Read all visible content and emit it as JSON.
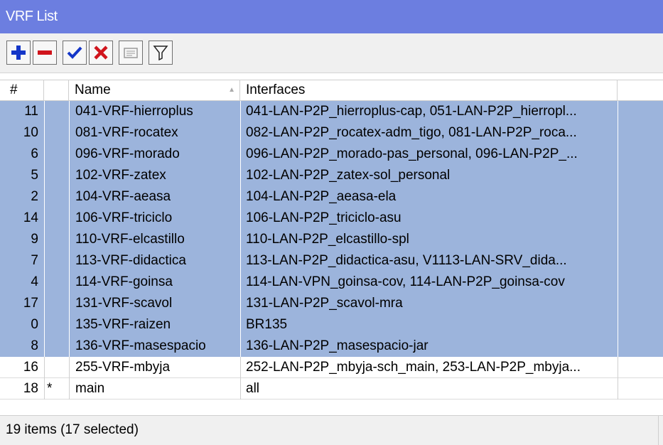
{
  "window": {
    "title": "VRF List"
  },
  "toolbar": {
    "buttons": [
      {
        "name": "add-button",
        "icon": "plus-icon"
      },
      {
        "name": "remove-button",
        "icon": "minus-icon"
      },
      {
        "name": "enable-button",
        "icon": "checkmark-icon"
      },
      {
        "name": "disable-button",
        "icon": "x-icon"
      },
      {
        "name": "comment-button",
        "icon": "comment-icon"
      },
      {
        "name": "filter-button",
        "icon": "filter-icon"
      }
    ]
  },
  "table": {
    "columns": {
      "num": "#",
      "flag": "",
      "name": "Name",
      "interfaces": "Interfaces"
    },
    "sort_indicator": "▲",
    "rows": [
      {
        "num": "11",
        "flag": "",
        "name": "041-VRF-hierroplus",
        "interfaces": "041-LAN-P2P_hierroplus-cap, 051-LAN-P2P_hierropl...",
        "selected": true
      },
      {
        "num": "10",
        "flag": "",
        "name": "081-VRF-rocatex",
        "interfaces": "082-LAN-P2P_rocatex-adm_tigo, 081-LAN-P2P_roca...",
        "selected": true
      },
      {
        "num": "6",
        "flag": "",
        "name": "096-VRF-morado",
        "interfaces": "096-LAN-P2P_morado-pas_personal, 096-LAN-P2P_...",
        "selected": true
      },
      {
        "num": "5",
        "flag": "",
        "name": "102-VRF-zatex",
        "interfaces": "102-LAN-P2P_zatex-sol_personal",
        "selected": true
      },
      {
        "num": "2",
        "flag": "",
        "name": "104-VRF-aeasa",
        "interfaces": "104-LAN-P2P_aeasa-ela",
        "selected": true
      },
      {
        "num": "14",
        "flag": "",
        "name": "106-VRF-triciclo",
        "interfaces": "106-LAN-P2P_triciclo-asu",
        "selected": true
      },
      {
        "num": "9",
        "flag": "",
        "name": "110-VRF-elcastillo",
        "interfaces": "110-LAN-P2P_elcastillo-spl",
        "selected": true
      },
      {
        "num": "7",
        "flag": "",
        "name": "113-VRF-didactica",
        "interfaces": "113-LAN-P2P_didactica-asu, V1113-LAN-SRV_dida...",
        "selected": true
      },
      {
        "num": "4",
        "flag": "",
        "name": "114-VRF-goinsa",
        "interfaces": "114-LAN-VPN_goinsa-cov, 114-LAN-P2P_goinsa-cov",
        "selected": true
      },
      {
        "num": "17",
        "flag": "",
        "name": "131-VRF-scavol",
        "interfaces": "131-LAN-P2P_scavol-mra",
        "selected": true
      },
      {
        "num": "0",
        "flag": "",
        "name": "135-VRF-raizen",
        "interfaces": "BR135",
        "selected": true
      },
      {
        "num": "8",
        "flag": "",
        "name": "136-VRF-masespacio",
        "interfaces": "136-LAN-P2P_masespacio-jar",
        "selected": true
      },
      {
        "num": "16",
        "flag": "",
        "name": "255-VRF-mbyja",
        "interfaces": "252-LAN-P2P_mbyja-sch_main, 253-LAN-P2P_mbyja...",
        "selected": false
      },
      {
        "num": "18",
        "flag": "*",
        "name": "main",
        "interfaces": "all",
        "selected": false
      }
    ]
  },
  "status": {
    "text": "19 items (17 selected)"
  },
  "colors": {
    "title_bg": "#6c7ee0",
    "selected_row": "#9cb4dc",
    "toolbar_bg": "#f0f0f0"
  }
}
